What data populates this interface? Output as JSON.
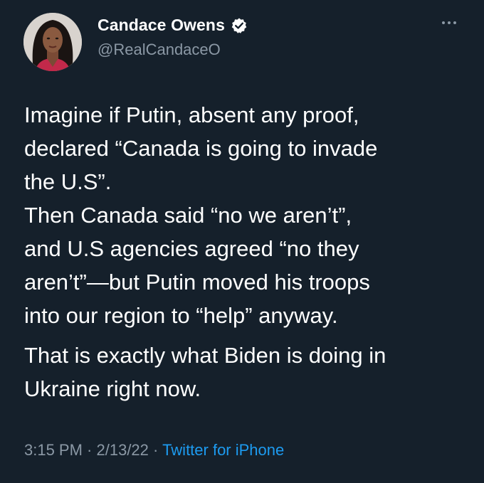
{
  "user": {
    "display_name": "Candace Owens",
    "handle": "@RealCandaceO",
    "verified": true,
    "avatar_icon": "profile-photo"
  },
  "tweet": {
    "paragraph_1": [
      "Imagine if Putin, absent any proof,",
      "declared “Canada is going to invade",
      "the U.S”.",
      "Then Canada said “no we aren’t”,",
      "and U.S agencies agreed “no they",
      "aren’t”—but Putin moved his troops",
      "into our region to “help” anyway."
    ],
    "paragraph_2": [
      "That is exactly what Biden is doing in",
      "Ukraine right now."
    ]
  },
  "meta": {
    "time": "3:15 PM",
    "separator": " · ",
    "date": "2/13/22",
    "source": "Twitter for iPhone"
  },
  "colors": {
    "background": "#15202b",
    "text": "#ffffff",
    "secondary_text": "#8b98a5",
    "link": "#1d9bf0",
    "verified_badge": "#ffffff"
  },
  "icons": {
    "verified": "verified-badge-icon",
    "more": "more-options-icon"
  }
}
